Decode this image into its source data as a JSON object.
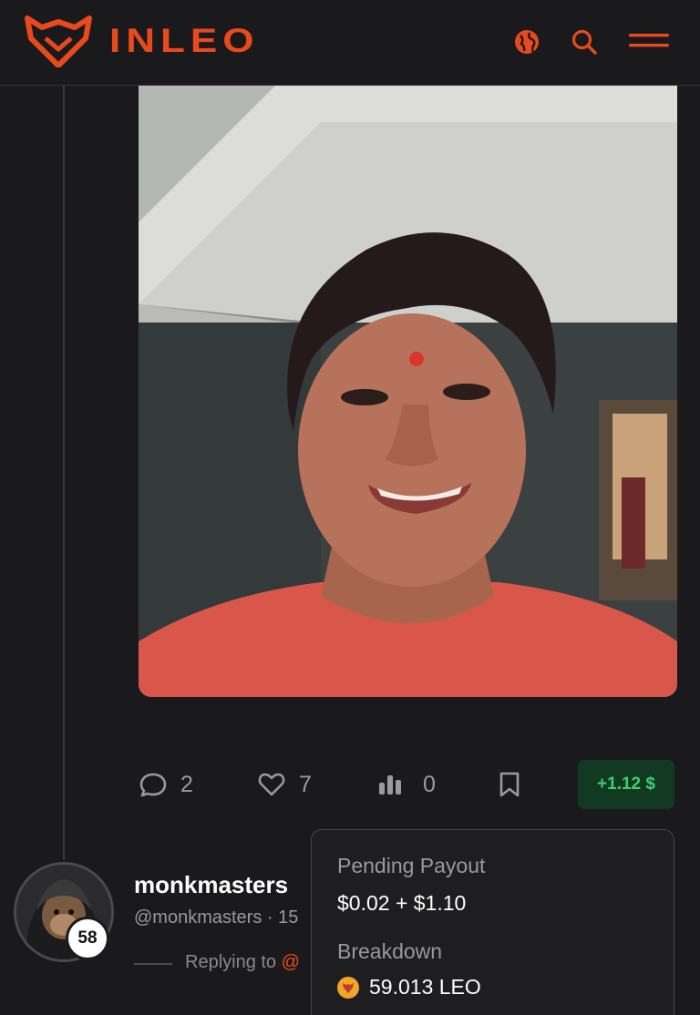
{
  "header": {
    "brand": "INLEO",
    "colors": {
      "accent": "#e8491d",
      "background": "#1a1a1c"
    },
    "icons": [
      "globe-icon",
      "search-icon",
      "hamburger-menu-icon"
    ]
  },
  "post": {
    "image_alt": "Selfie photo",
    "actions": {
      "comments": "2",
      "likes": "7",
      "stats": "0",
      "payout": "+1.12 $"
    }
  },
  "reply": {
    "username": "monkmasters",
    "handle": "@monkmasters · 15",
    "reputation": "58",
    "replying_prefix": "Replying to ",
    "replying_at": "@"
  },
  "tooltip": {
    "pending_label": "Pending Payout",
    "pending_value": "$0.02 + $1.10",
    "breakdown_label": "Breakdown",
    "leo_amount": "59.013 LEO"
  }
}
